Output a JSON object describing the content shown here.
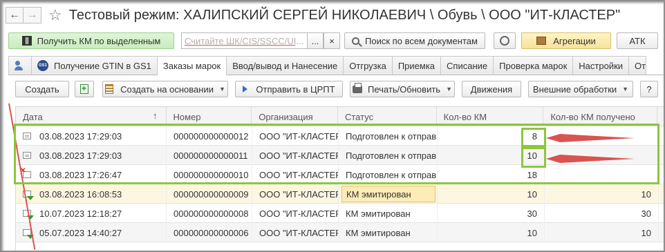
{
  "window": {
    "title": "Тестовый режим:  ХАЛИПСКИЙ СЕРГЕЙ НИКОЛАЕВИЧ \\ Обувь \\ ООО \"ИТ-КЛАСТЕР\""
  },
  "toolbar_top": {
    "get_km_label": "Получить КМ по выделенным",
    "scan_placeholder": "Считайте ШК/CIS/SSCC/UI...",
    "more_label": "...",
    "clear_label": "×",
    "search_all_label": "Поиск по всем документам",
    "aggregation_label": "Агрегации",
    "atk_label": "АТК"
  },
  "tabs": [
    {
      "label": ""
    },
    {
      "label": "Получение GTIN в GS1"
    },
    {
      "label": "Заказы марок",
      "active": true
    },
    {
      "label": "Ввод/вывод и Нанесение"
    },
    {
      "label": "Отгрузка"
    },
    {
      "label": "Приемка"
    },
    {
      "label": "Списание"
    },
    {
      "label": "Проверка марок"
    },
    {
      "label": "Настройки"
    },
    {
      "label": "От"
    }
  ],
  "gs1_badge": "GS1",
  "toolbar_list": {
    "create_label": "Создать",
    "create_based_label": "Создать на основании",
    "send_label": "Отправить в ЦРПТ",
    "print_label": "Печать/Обновить",
    "movements_label": "Движения",
    "external_label": "Внешние обработки",
    "help_label": "?"
  },
  "table": {
    "columns": [
      "Дата",
      "Номер",
      "Организация",
      "Статус",
      "Кол-во КМ",
      "Кол-во КМ получено"
    ],
    "sort_indicator": "↑",
    "rows": [
      {
        "icon": "doc-icon",
        "date": "03.08.2023 17:29:03",
        "number": "000000000000012",
        "org": "ООО \"ИТ-КЛАСТЕР\"",
        "status": "Подготовлен к отправке",
        "km": "8",
        "received": ""
      },
      {
        "icon": "doc-icon",
        "date": "03.08.2023 17:29:03",
        "number": "000000000000011",
        "org": "ООО \"ИТ-КЛАСТЕР\"",
        "status": "Подготовлен к отправке",
        "km": "10",
        "received": ""
      },
      {
        "icon": "deleted-doc-icon",
        "date": "03.08.2023 17:26:47",
        "number": "000000000000010",
        "org": "ООО \"ИТ-КЛАСТЕР\"",
        "status": "Подготовлен к отправке",
        "km": "18",
        "received": ""
      },
      {
        "icon": "posted-doc-icon",
        "date": "03.08.2023 16:08:53",
        "number": "000000000000009",
        "org": "ООО \"ИТ-КЛАСТЕР\"",
        "status": "КМ эмитирован",
        "km": "10",
        "received": "10"
      },
      {
        "icon": "posted-doc-icon",
        "date": "10.07.2023 12:18:27",
        "number": "000000000000008",
        "org": "ООО \"ИТ-КЛАСТЕР\"",
        "status": "КМ эмитирован",
        "km": "30",
        "received": "30"
      },
      {
        "icon": "posted-doc-icon",
        "date": "05.07.2023 14:40:27",
        "number": "000000000000006",
        "org": "ООО \"ИТ-КЛАСТЕР\"",
        "status": "КМ эмитирован",
        "km": "10",
        "received": "10"
      }
    ]
  },
  "colors": {
    "annotation_green": "#8cc63f",
    "annotation_red": "#d9534f",
    "selected_row": "#fdf6e1"
  }
}
